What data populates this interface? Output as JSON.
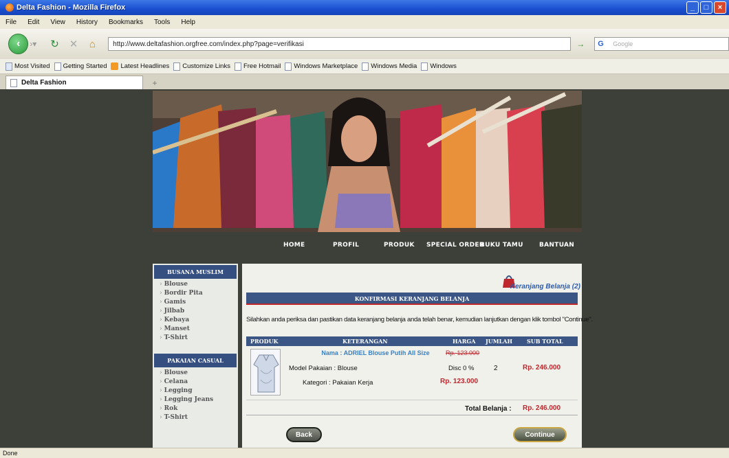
{
  "window": {
    "title": "Delta Fashion - Mozilla Firefox"
  },
  "menu": [
    "File",
    "Edit",
    "View",
    "History",
    "Bookmarks",
    "Tools",
    "Help"
  ],
  "url": "http://www.deltafashion.orgfree.com/index.php?page=verifikasi",
  "search_placeholder": "Google",
  "bookmarks": [
    "Most Visited",
    "Getting Started",
    "Latest Headlines",
    "Customize Links",
    "Free Hotmail",
    "Windows Marketplace",
    "Windows Media",
    "Windows"
  ],
  "tab": {
    "label": "Delta Fashion"
  },
  "status": "Done",
  "site": {
    "nav": [
      "HOME",
      "PROFIL",
      "PRODUK",
      "SPECIAL ORDER",
      "BUKU TAMU",
      "BANTUAN"
    ],
    "sidebar": {
      "section1_title": "BUSANA MUSLIM",
      "section1_items": [
        "Blouse",
        "Bordir Pita",
        "Gamis",
        "Jilbab",
        "Kebaya",
        "Manset",
        "T-Shirt"
      ],
      "section2_title": "PAKAIAN CASUAL",
      "section2_items": [
        "Blouse",
        "Celana",
        "Legging",
        "Legging Jeans",
        "Rok",
        "T-Shirt"
      ]
    },
    "cart_link": "Keranjang Belanja (2)",
    "section_title": "KONFIRMASI KERANJANG BELANJA",
    "instruction": "Silahkan anda periksa dan pastikan data keranjang belanja anda telah benar, kemudian lanjutkan dengan klik tombol \"Continue\".",
    "table_headers": {
      "produk": "PRODUK",
      "keterangan": "KETERANGAN",
      "harga": "HARGA",
      "jumlah": "JUMLAH",
      "subtotal": "SUB TOTAL"
    },
    "item": {
      "name": "Nama : ADRIEL Blouse Putih All Size",
      "model": "Model Pakaian : Blouse",
      "kategori": "Kategori : Pakaian Kerja",
      "price_original": "Rp. 123.000",
      "discount": "Disc 0 %",
      "price_final": "Rp. 123.000",
      "qty": "2",
      "subtotal": "Rp. 246.000"
    },
    "total_label": "Total Belanja :",
    "total_value": "Rp. 246.000",
    "back_label": "Back",
    "continue_label": "Continue"
  }
}
